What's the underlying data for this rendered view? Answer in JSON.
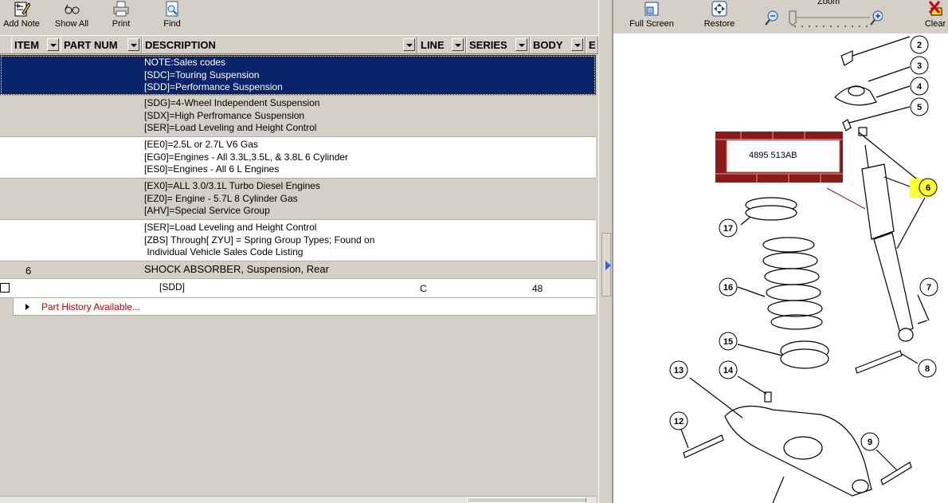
{
  "toolbar": {
    "add_note": "Add Note",
    "show_all": "Show All",
    "print": "Print",
    "find": "Find"
  },
  "grid": {
    "columns": [
      "ITEM",
      "PART NUM",
      "DESCRIPTION",
      "LINE",
      "SERIES",
      "BODY",
      "E"
    ],
    "rows": [
      {
        "lines": "NOTE:Sales codes\n[SDC]=Touring Suspension\n[SDD]=Performance Suspension"
      },
      {
        "lines": "[SDG]=4-Wheel Independent Suspension\n[SDX]=High Perfromance Suspension\n[SER]=Load Leveling and Height Control"
      },
      {
        "lines": "[EE0]=2.5L or 2.7L V6 Gas\n[EG0]=Engines - All 3.3L,3.5L, & 3.8L 6 Cylinder\n[ES0]=Engines - All 6 L Engines"
      },
      {
        "lines": "[EX0]=ALL 3.0/3.1L Turbo Diesel Engines\n[EZ0]= Engine - 5.7L 8 Cylinder Gas\n[AHV]=Special Service Group"
      },
      {
        "lines": "[SER]=Load Leveling and Height Control\n[ZBS] Through[ ZYU] = Spring Group Types; Found on\n Individual Vehicle Sales Code Listing"
      }
    ],
    "item_row": {
      "item": "6",
      "description": "SHOCK ABSORBER, Suspension, Rear"
    },
    "part_row": {
      "code": "[SDD]",
      "line": "C",
      "body": "48"
    },
    "history_link": "Part History Available..."
  },
  "viewer": {
    "full_screen": "Full Screen",
    "restore": "Restore",
    "zoom_label": "Zoom",
    "clear": "Clear",
    "zoom_level": 0.0
  },
  "diagram": {
    "part_label": "4895 513AB",
    "callouts": [
      "2",
      "3",
      "4",
      "5",
      "6",
      "7",
      "8",
      "9",
      "12",
      "13",
      "14",
      "15",
      "16",
      "17"
    ],
    "highlight_callout": "6",
    "highlight_color": "#ffff33",
    "label_border_color": "#8b1a1a"
  }
}
